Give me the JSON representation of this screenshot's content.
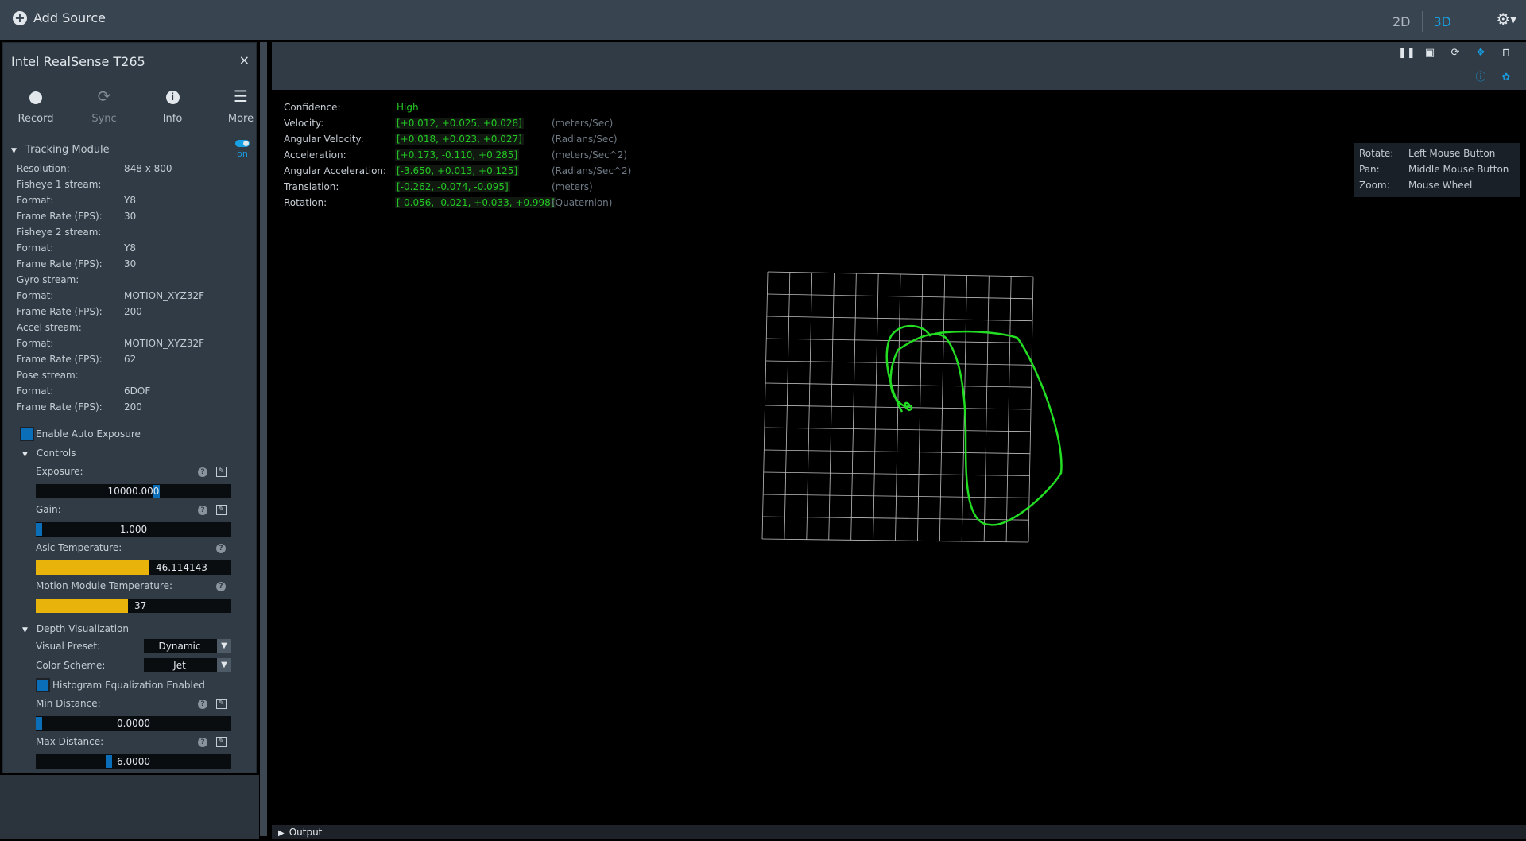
{
  "topbar": {
    "add_source_label": "Add Source",
    "view_2d": "2D",
    "view_3d": "3D",
    "active_view": "3D"
  },
  "device": {
    "name": "Intel RealSense T265",
    "close_glyph": "×",
    "tools": [
      {
        "label": "Record",
        "icon": "record-icon",
        "enabled": true
      },
      {
        "label": "Sync",
        "icon": "sync-icon",
        "enabled": false
      },
      {
        "label": "Info",
        "icon": "info-icon",
        "enabled": true
      },
      {
        "label": "More",
        "icon": "menu-icon",
        "enabled": true
      }
    ]
  },
  "tracking_module": {
    "title": "Tracking Module",
    "toggle_label": "on",
    "props": [
      {
        "label": "Resolution:",
        "value": "848 x 800"
      },
      {
        "label": "Fisheye 1 stream:",
        "value": ""
      },
      {
        "label": "Format:",
        "value": "Y8"
      },
      {
        "label": "Frame Rate (FPS):",
        "value": "30"
      },
      {
        "label": "Fisheye 2 stream:",
        "value": ""
      },
      {
        "label": "Format:",
        "value": "Y8"
      },
      {
        "label": "Frame Rate (FPS):",
        "value": "30"
      },
      {
        "label": "Gyro stream:",
        "value": ""
      },
      {
        "label": "Format:",
        "value": "MOTION_XYZ32F"
      },
      {
        "label": "Frame Rate (FPS):",
        "value": "200"
      },
      {
        "label": "Accel stream:",
        "value": ""
      },
      {
        "label": "Format:",
        "value": "MOTION_XYZ32F"
      },
      {
        "label": "Frame Rate (FPS):",
        "value": "62"
      },
      {
        "label": "Pose stream:",
        "value": ""
      },
      {
        "label": "Format:",
        "value": "6DOF"
      },
      {
        "label": "Frame Rate (FPS):",
        "value": "200"
      }
    ],
    "auto_exposure_label": "Enable Auto Exposure",
    "controls_title": "Controls",
    "exposure": {
      "label": "Exposure:",
      "value": "10000.000",
      "fraction": 0.62
    },
    "gain": {
      "label": "Gain:",
      "value": "1.000",
      "fraction": 0.0
    },
    "asic_temp": {
      "label": "Asic Temperature:",
      "value": "46.114143",
      "fraction": 0.58
    },
    "motion_temp": {
      "label": "Motion Module Temperature:",
      "value": "37",
      "fraction": 0.47
    },
    "depth_vis_title": "Depth Visualization",
    "visual_preset": {
      "label": "Visual Preset:",
      "value": "Dynamic"
    },
    "color_scheme": {
      "label": "Color Scheme:",
      "value": "Jet"
    },
    "histogram_label": "Histogram Equalization Enabled",
    "min_distance": {
      "label": "Min Distance:",
      "value": "0.0000",
      "fraction": 0.0
    },
    "max_distance": {
      "label": "Max Distance:",
      "value": "6.0000",
      "fraction": 0.37
    }
  },
  "viewer": {
    "toolbar_icons": [
      "pause-icon",
      "save-icon",
      "refresh-icon",
      "layers-icon",
      "lock-icon",
      "info-icon",
      "paw-icon"
    ],
    "metrics": [
      {
        "label": "Confidence:",
        "value": "High",
        "unit": ""
      },
      {
        "label": "Velocity:",
        "value": "[+0.012, +0.025, +0.028]",
        "unit": "(meters/Sec)"
      },
      {
        "label": "Angular Velocity:",
        "value": "[+0.018, +0.023, +0.027]",
        "unit": "(Radians/Sec)"
      },
      {
        "label": "Acceleration:",
        "value": "[+0.173, -0.110, +0.285]",
        "unit": "(meters/Sec^2)"
      },
      {
        "label": "Angular Acceleration:",
        "value": "[-3.650, +0.013, +0.125]",
        "unit": "(Radians/Sec^2)"
      },
      {
        "label": "Translation:",
        "value": "[-0.262, -0.074, -0.095]",
        "unit": "(meters)"
      },
      {
        "label": "Rotation:",
        "value": "[-0.056, -0.021, +0.033, +0.998]",
        "unit": "(Quaternion)"
      }
    ],
    "hints": [
      {
        "label": "Rotate:",
        "value": "Left Mouse Button"
      },
      {
        "label": "Pan:",
        "value": "Middle Mouse Button"
      },
      {
        "label": "Zoom:",
        "value": "Mouse Wheel"
      }
    ],
    "trajectory_color": "#22dd22"
  },
  "output": {
    "label": "Output"
  }
}
